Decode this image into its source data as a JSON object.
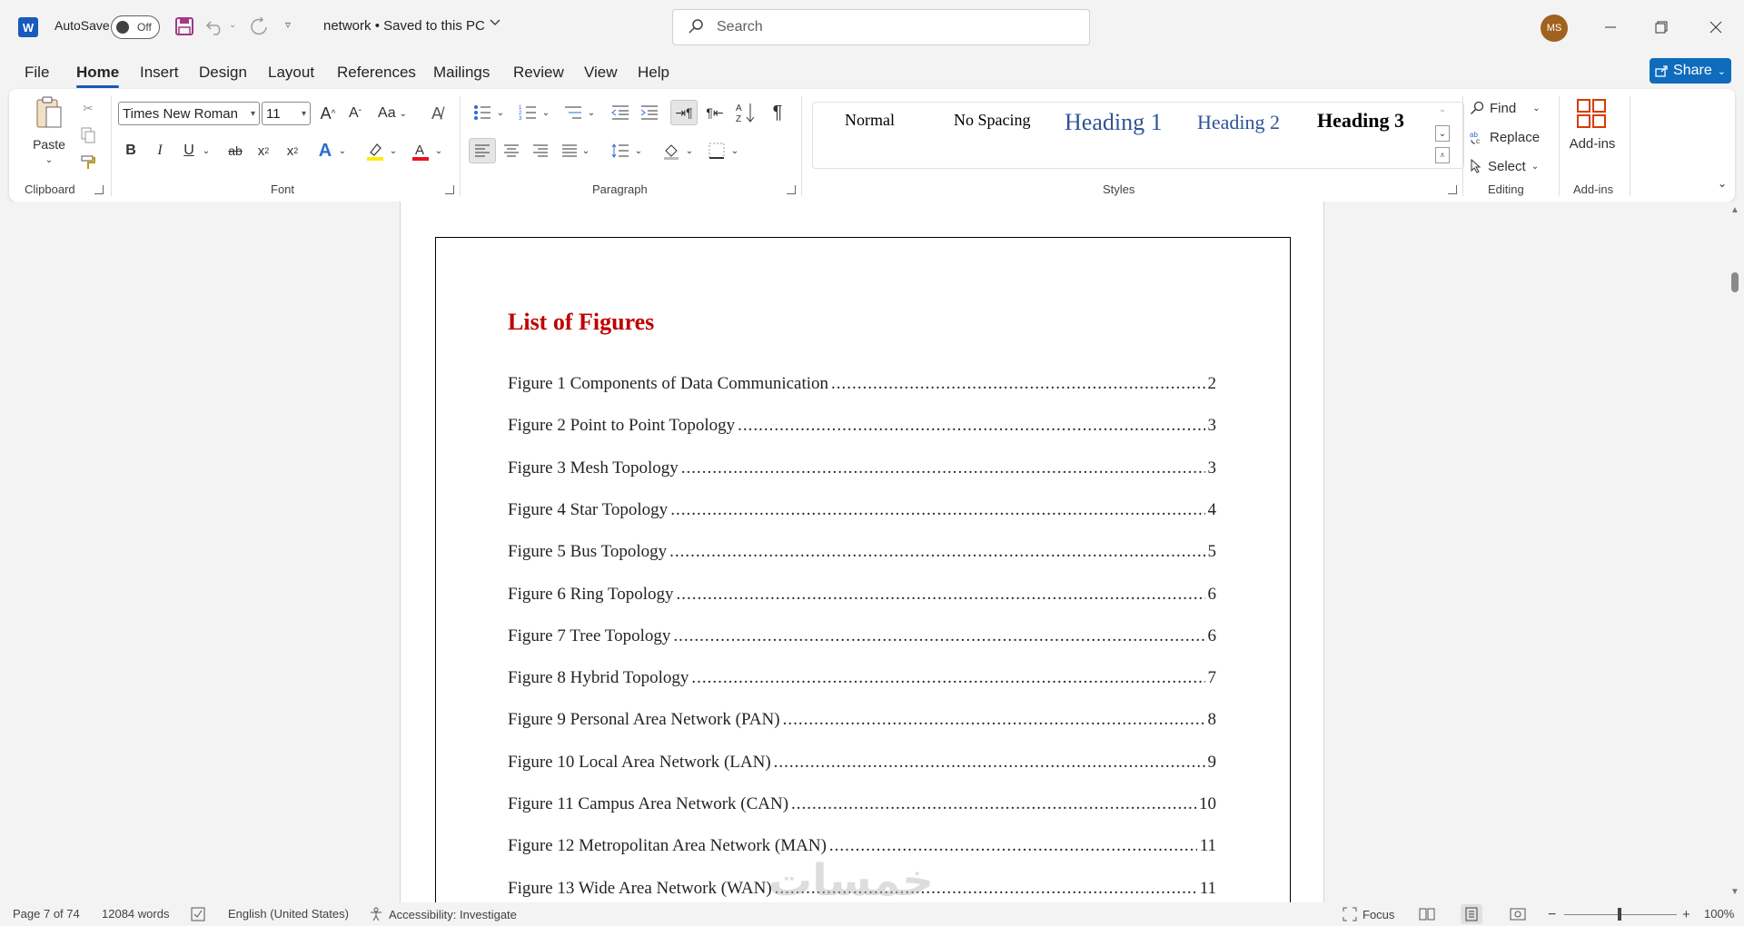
{
  "titlebar": {
    "app_icon_letter": "W",
    "autosave_label": "AutoSave",
    "autosave_state": "Off",
    "document_title": "network • Saved to this PC",
    "search_placeholder": "Search",
    "user_initials": "MS"
  },
  "menu": {
    "tabs": [
      "File",
      "Home",
      "Insert",
      "Design",
      "Layout",
      "References",
      "Mailings",
      "Review",
      "View",
      "Help"
    ],
    "active_tab": "Home",
    "share_label": "Share"
  },
  "ribbon": {
    "clipboard": {
      "paste_label": "Paste",
      "group_label": "Clipboard"
    },
    "font": {
      "font_name": "Times New Roman",
      "font_size": "11",
      "change_case": "Aa",
      "group_label": "Font"
    },
    "paragraph": {
      "group_label": "Paragraph"
    },
    "styles": {
      "items": [
        "Normal",
        "No Spacing",
        "Heading 1",
        "Heading 2",
        "Heading 3"
      ],
      "group_label": "Styles"
    },
    "editing": {
      "find_label": "Find",
      "replace_label": "Replace",
      "select_label": "Select",
      "group_label": "Editing"
    },
    "addins": {
      "button_label": "Add-ins",
      "group_label": "Add-ins"
    }
  },
  "document": {
    "heading": "List of Figures",
    "entries": [
      {
        "label": "Figure 1 Components of Data Communication",
        "page": "2"
      },
      {
        "label": "Figure 2 Point to Point Topology",
        "page": "3"
      },
      {
        "label": "Figure 3 Mesh Topology",
        "page": "3"
      },
      {
        "label": "Figure 4 Star Topology",
        "page": "4"
      },
      {
        "label": "Figure 5 Bus Topology",
        "page": "5"
      },
      {
        "label": "Figure 6 Ring Topology",
        "page": "6"
      },
      {
        "label": "Figure 7 Tree Topology",
        "page": "6"
      },
      {
        "label": "Figure 8 Hybrid Topology",
        "page": "7"
      },
      {
        "label": "Figure 9 Personal Area Network (PAN)",
        "page": "8"
      },
      {
        "label": "Figure 10 Local Area Network (LAN)",
        "page": "9"
      },
      {
        "label": "Figure 11 Campus Area Network (CAN)",
        "page": "10"
      },
      {
        "label": "Figure 12 Metropolitan Area Network (MAN)",
        "page": "11"
      },
      {
        "label": "Figure 13 Wide Area Network (WAN)",
        "page": "11"
      }
    ],
    "watermark": "خمسات"
  },
  "statusbar": {
    "page_info": "Page 7 of 74",
    "word_count": "12084 words",
    "language": "English (United States)",
    "accessibility": "Accessibility: Investigate",
    "focus_label": "Focus",
    "zoom_level": "100%"
  },
  "colors": {
    "accent": "#185abd",
    "heading_red": "#c00000",
    "share_blue": "#0f6cbd"
  }
}
